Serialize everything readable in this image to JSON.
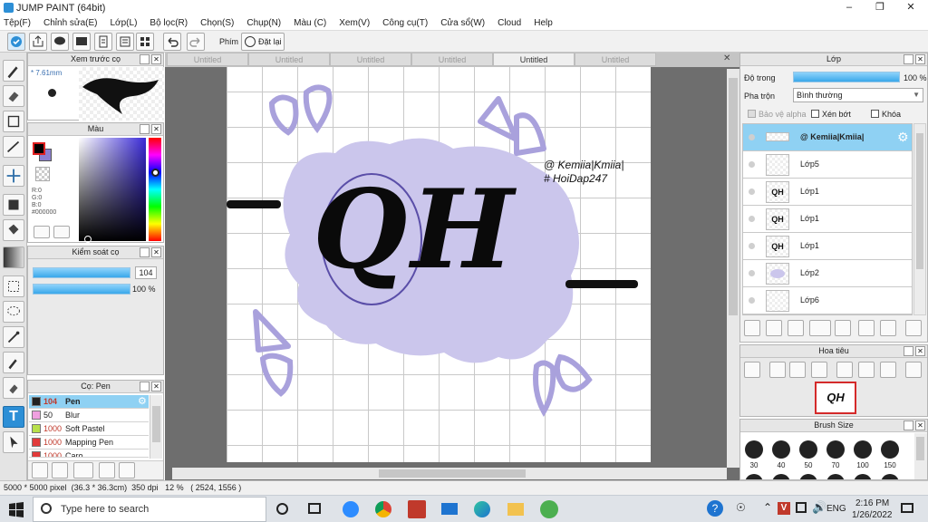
{
  "app": {
    "title": "JUMP PAINT (64bit)"
  },
  "menu": [
    "Tệp(F)",
    "Chỉnh sửa(E)",
    "Lớp(L)",
    "Bộ lọc(R)",
    "Chọn(S)",
    "Chụp(N)",
    "Màu (C)",
    "Xem(V)",
    "Công cụ(T)",
    "Cửa sổ(W)",
    "Cloud",
    "Help"
  ],
  "toolbar": {
    "key_label": "Phím",
    "reset_label": "Đặt lại"
  },
  "tabs": [
    "Untitled",
    "Untitled",
    "Untitled",
    "Untitled",
    "Untitled",
    "Untitled"
  ],
  "brush_preview": {
    "title": "Xem trước cọ",
    "size": "* 7.61mm"
  },
  "color_panel": {
    "title": "Màu",
    "r": "R:0",
    "g": "G:0",
    "b": "B:0",
    "hex": "#000000"
  },
  "brush_control": {
    "title": "Kiểm soát cọ",
    "size_value": "104",
    "opacity_value": "100 %"
  },
  "brush_list": {
    "title": "Cọ: Pen",
    "items": [
      {
        "size": "104",
        "name": "Pen",
        "color": "#222222"
      },
      {
        "size": "50",
        "name": "Blur",
        "color": "#f0a0e0"
      },
      {
        "size": "1000",
        "name": "Soft Pastel",
        "color": "#b8e04a"
      },
      {
        "size": "1000",
        "name": "Mapping Pen",
        "color": "#e23a3a"
      },
      {
        "size": "1000",
        "name": "Caro",
        "color": "#e23a3a"
      }
    ]
  },
  "artwork": {
    "text1": "@ Kemiia|Kmiia|",
    "text2": "# HoiDap247",
    "letters": "QH"
  },
  "layers_panel": {
    "title": "Lớp",
    "opacity_label": "Độ trong",
    "opacity_value": "100 %",
    "blend_label": "Pha trộn",
    "blend_value": "Bình thường",
    "protect_alpha": "Bảo vệ alpha",
    "clip": "Xén bớt",
    "lock": "Khóa",
    "layers": [
      {
        "name": "@ Kemiia|Kmiia|",
        "thumb": "",
        "selected": true
      },
      {
        "name": "Lớp5",
        "thumb": ""
      },
      {
        "name": "Lớp1",
        "thumb": "QH"
      },
      {
        "name": "Lớp1",
        "thumb": "QH"
      },
      {
        "name": "Lớp1",
        "thumb": "QH"
      },
      {
        "name": "Lớp2",
        "thumb": ""
      },
      {
        "name": "Lớp6",
        "thumb": ""
      }
    ]
  },
  "navigator": {
    "title": "Hoa tiêu",
    "thumb_text": "QH"
  },
  "brush_size": {
    "title": "Brush Size",
    "sizes": [
      "30",
      "40",
      "50",
      "70",
      "100",
      "150"
    ]
  },
  "status": {
    "dimensions": "5000 * 5000 pixel",
    "cm": "(36.3 * 36.3cm)",
    "dpi": "350 dpi",
    "zoom": "12 %",
    "coords": "( 2524, 1556 )"
  },
  "taskbar": {
    "search_placeholder": "Type here to search",
    "lang": "ENG",
    "time": "2:16 PM",
    "date": "1/26/2022"
  },
  "colors": {
    "accent": "#2d8fd6",
    "lavender": "#cbc6ec",
    "outline": "#a9a1dc",
    "layer_selected": "#8fd1f3"
  }
}
